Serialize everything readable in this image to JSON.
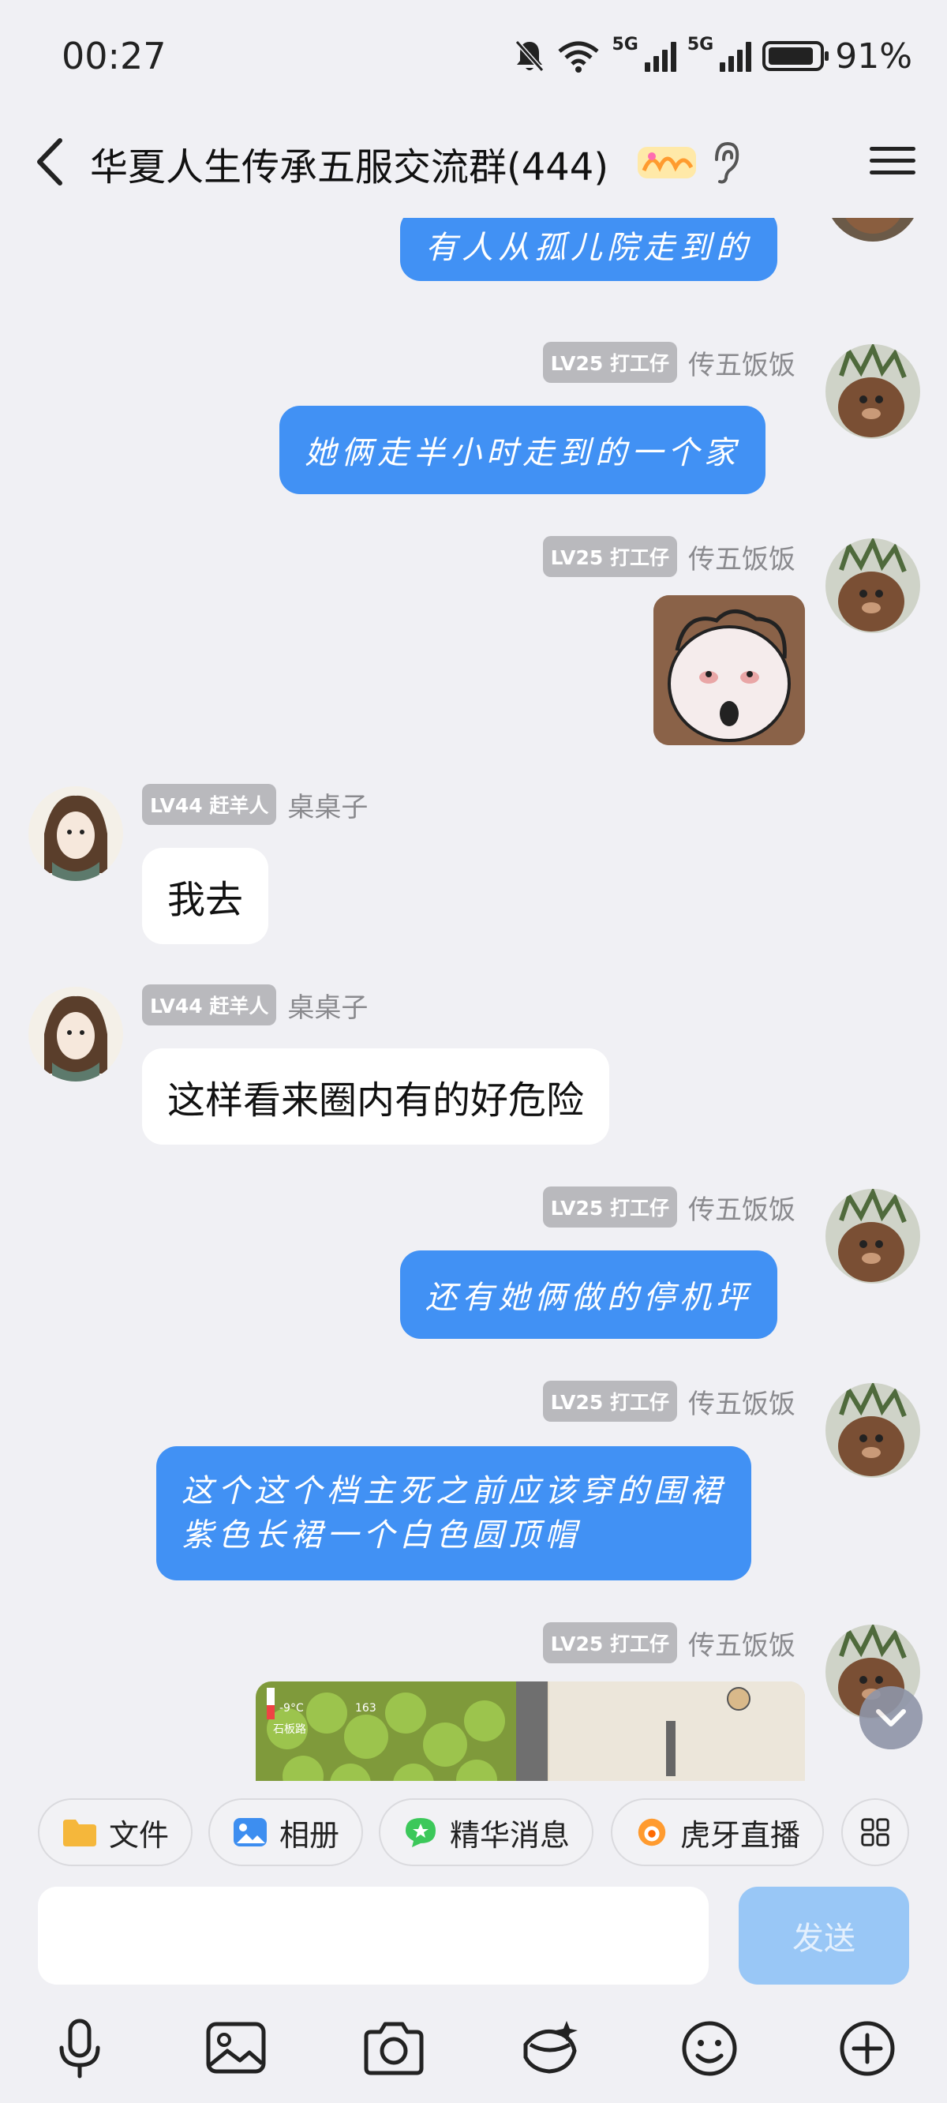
{
  "status": {
    "time": "00:27",
    "net1": "5G",
    "net2": "5G",
    "battery": "91%"
  },
  "header": {
    "title": "华夏人生传承五服交流群(444)"
  },
  "messages": [
    {
      "side": "out",
      "text": "有人从孤儿院走到的"
    },
    {
      "side": "out",
      "level": "LV25 打工仔",
      "name": "传五饭饭",
      "text": "她俩走半小时走到的一个家"
    },
    {
      "side": "out",
      "level": "LV25 打工仔",
      "name": "传五饭饭",
      "type": "sticker"
    },
    {
      "side": "in",
      "level": "LV44 赶羊人",
      "name": "桌桌子",
      "text": "我去"
    },
    {
      "side": "in",
      "level": "LV44 赶羊人",
      "name": "桌桌子",
      "text": "这样看来圈内有的好危险"
    },
    {
      "side": "out",
      "level": "LV25 打工仔",
      "name": "传五饭饭",
      "text": "还有她俩做的停机坪"
    },
    {
      "side": "out",
      "level": "LV25 打工仔",
      "name": "传五饭饭",
      "line1": "这个这个档主死之前应该穿的围裙",
      "line2": "紫色长裙一个白色圆顶帽"
    },
    {
      "side": "out",
      "level": "LV25 打工仔",
      "name": "传五饭饭",
      "type": "image",
      "hud_temp": "-9°C",
      "hud_count": "163",
      "hud_place": "石板路"
    }
  ],
  "quick_actions": [
    "文件",
    "相册",
    "精华消息",
    "虎牙直播"
  ],
  "input": {
    "placeholder": "",
    "send_label": "发送"
  },
  "toolbar": [
    "microphone-icon",
    "image-icon",
    "camera-icon",
    "red-packet-icon",
    "emoji-icon",
    "plus-icon"
  ],
  "colors": {
    "bubble_out": "#4191f4",
    "bubble_in": "#ffffff",
    "background": "#f0f0f4",
    "send_disabled": "#99c7f6"
  }
}
